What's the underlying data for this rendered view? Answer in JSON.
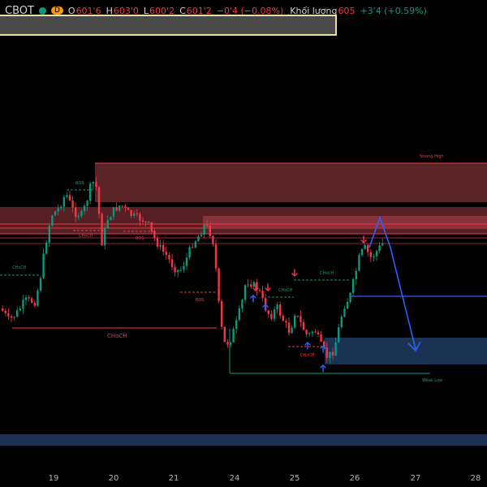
{
  "header": {
    "symbol": "CBOT",
    "interval": "D",
    "open_key": "O",
    "open_val": "601'6",
    "high_key": "H",
    "high_val": "603'0",
    "low_key": "L",
    "low_val": "600'2",
    "close_key": "C",
    "close_val": "601'2",
    "change": "−0'4 (−0.08%)",
    "volume_label": "Khối lượng",
    "volume_val": "605",
    "volume_change": "+3'4 (+0.59%)"
  },
  "labels": {
    "strong_high": "Strong High",
    "weak_low": "Weak Low",
    "choch_main": "CHoCH",
    "choch_left": "CHoCH",
    "bos_top": "BOS",
    "choch_top": "CHoCH",
    "bos_mid": "BOS",
    "bos_low": "BOS",
    "choch_mid": "CHoCH",
    "choch_right": "CHoCH",
    "choch_bottom": "CHoCH"
  },
  "x_axis": [
    "19",
    "20",
    "21",
    "24",
    "25",
    "26",
    "27",
    "28"
  ],
  "colors": {
    "bull": "#089981",
    "bear": "#f23645",
    "projection": "#2962ff",
    "supply_zone": "#b2424a",
    "demand_zone": "#2962ff"
  }
}
